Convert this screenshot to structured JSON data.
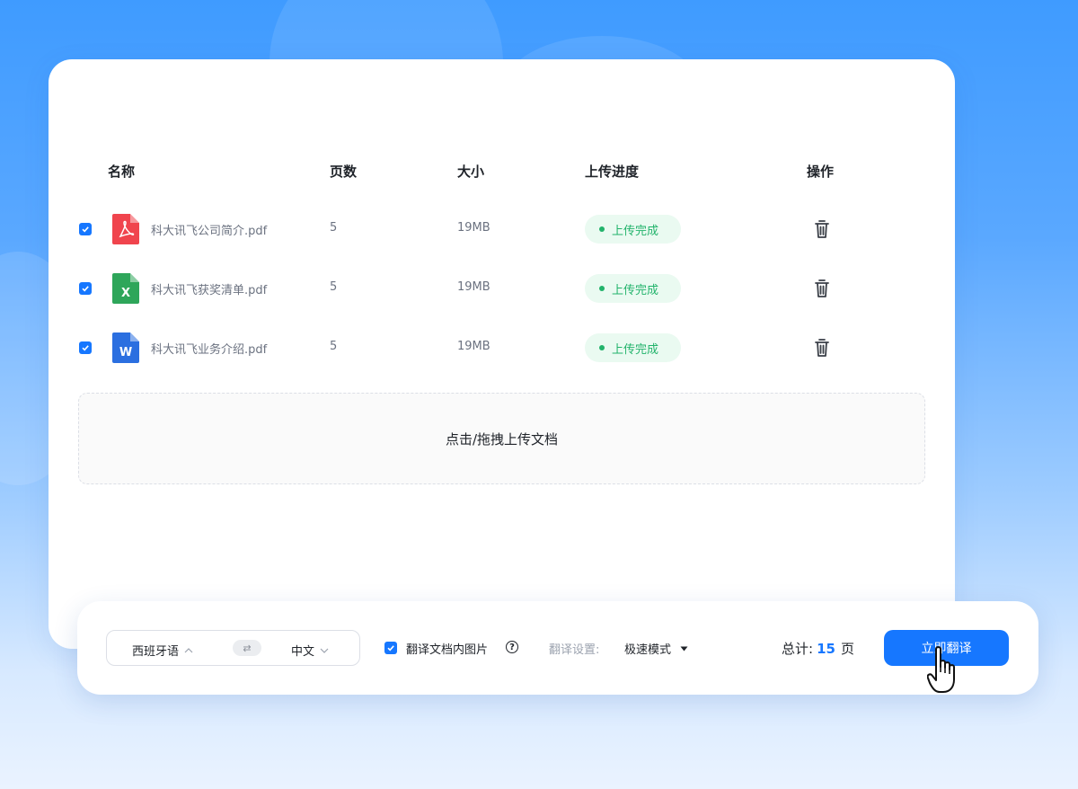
{
  "table": {
    "headers": {
      "name": "名称",
      "pages": "页数",
      "size": "大小",
      "progress": "上传进度",
      "actions": "操作"
    },
    "rows": [
      {
        "name": "科大讯飞公司简介.pdf",
        "pages": "5",
        "size": "19MB",
        "status": "上传完成",
        "file_icon": "pdf-file-icon",
        "color": "#f0444d",
        "glyph": "pdf"
      },
      {
        "name": "科大讯飞获奖清单.pdf",
        "pages": "5",
        "size": "19MB",
        "status": "上传完成",
        "file_icon": "excel-file-icon",
        "color": "#2ea65a",
        "glyph": "X"
      },
      {
        "name": "科大讯飞业务介绍.pdf",
        "pages": "5",
        "size": "19MB",
        "status": "上传完成",
        "file_icon": "word-file-icon",
        "color": "#2b6fe0",
        "glyph": "W"
      }
    ]
  },
  "upload": {
    "label": "点击/拖拽上传文档"
  },
  "toolbar": {
    "source_lang": "西班牙语",
    "swap_icon": "swap-icon",
    "target_lang": "中文",
    "translate_images_label": "翻译文档内图片",
    "settings_label": "翻译设置:",
    "mode": "极速模式",
    "total_label": "总计:",
    "total_pages": "15",
    "total_unit": "页",
    "translate_button": "立即翻译"
  },
  "colors": {
    "accent": "#1677ff",
    "success": "#22b36b"
  }
}
